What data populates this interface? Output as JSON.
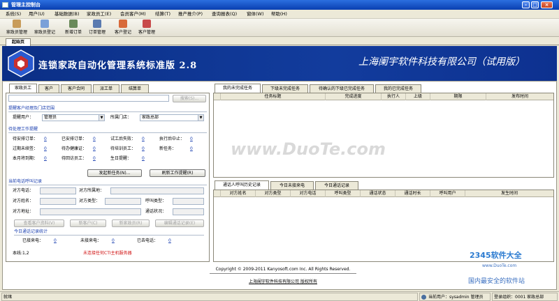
{
  "window": {
    "title": "管理主控制台"
  },
  "menu": [
    "系统(S)",
    "用户(U)",
    "基础数据(B)",
    "家政员工(E)",
    "会员客户(M)",
    "结算(T)",
    "推产推介(P)",
    "查询报表(Q)",
    "窗体(W)",
    "帮助(H)"
  ],
  "toolbar": [
    "家政员管理",
    "家政员登记",
    "新增订单",
    "订单管理",
    "客户登记",
    "客户管理"
  ],
  "page_tab": "起始页",
  "banner": {
    "title": "连锁家政自动化管理系统标准版 2.8",
    "company": "上海阑宇软件科技有限公司（试用版）"
  },
  "left_tabs": [
    "家政员工",
    "客户",
    "客户合同",
    "派工单",
    "结算单"
  ],
  "search_button": "搜索(S)...",
  "reminder": {
    "section_title": "提醒客户经理及门店范围",
    "user_label": "提醒用户：",
    "user_value": "管理员",
    "store_label": "所属门店：",
    "store_value": "家政总部"
  },
  "pending": {
    "section_title": "待处理工作提醒",
    "items": [
      {
        "label": "待安排订单：",
        "value": "0"
      },
      {
        "label": "已安排订单：",
        "value": "0"
      },
      {
        "label": "试工后失败：",
        "value": "0"
      },
      {
        "label": "执行后中止：",
        "value": "0"
      },
      {
        "label": "过期未续签：",
        "value": "0"
      },
      {
        "label": "待办健康证：",
        "value": "0"
      },
      {
        "label": "待培训员工：",
        "value": "0"
      },
      {
        "label": "新任务：",
        "value": "0"
      },
      {
        "label": "本月将到期：",
        "value": "0"
      },
      {
        "label": "待回访员工：",
        "value": "0"
      },
      {
        "label": "生日提醒：",
        "value": "0"
      }
    ],
    "new_task_button": "发起新任务(N)...",
    "refresh_button": "刷新工作提醒(R)"
  },
  "call": {
    "section_title": "当前电话呼叫记录",
    "phone_label": "对方电话：",
    "area_label": "对方所属地：",
    "name_label": "对方姓名：",
    "type_label": "对方类型：",
    "call_type_label": "呼叫类型：",
    "addr_label": "对方地址：",
    "status_label": "通话状况：",
    "buttons": [
      "查看客户资料(V)",
      "新客户(C)",
      "新家政员(R)",
      "编辑通话记录(E)"
    ]
  },
  "today_stats": {
    "section_title": "今日通话记录统计",
    "answered_label": "已接来电：",
    "answered_value": "0",
    "missed_label": "未接来电：",
    "missed_value": "0",
    "dialed_label": "已去电话：",
    "dialed_value": "0"
  },
  "local_line": "本线:1,2",
  "cti_warning": "未连接任何CTI主机服务器",
  "task_tabs": [
    "我的未完成任务",
    "下级未完成任务",
    "待确认的下级已完成任务",
    "我的已完成任务"
  ],
  "task_columns": [
    "任务标题",
    "完成进度",
    "执行人",
    "上级",
    "期限",
    "发布时间"
  ],
  "call_tabs": [
    "通话人呼叫历史记录",
    "今日未接来电",
    "今日通话记录"
  ],
  "call_columns": [
    "对方姓名",
    "对方类型",
    "对方电话",
    "呼叫类型",
    "通话状态",
    "通话时长",
    "呼叫用户",
    "发生时间"
  ],
  "footer": {
    "copyright": "Copyright © 2009-2011 Kanyosoft.com Inc. All Rights Reserved.",
    "owner": "上海阑宇软件科技有限公司 版权所有"
  },
  "watermark": "www.DuoTe.com",
  "brand": {
    "name": "2345软件大全",
    "url": "www.DuoTe.com",
    "slogan": "国内最安全的软件站"
  },
  "status": {
    "ready": "就绪",
    "user": "当前用户：sysadmin 管理员",
    "org": "登录组织：0001 家政总部"
  },
  "colors": {
    "banner": "#123c9d",
    "link": "#1a3fb0",
    "warning": "#d01010"
  }
}
